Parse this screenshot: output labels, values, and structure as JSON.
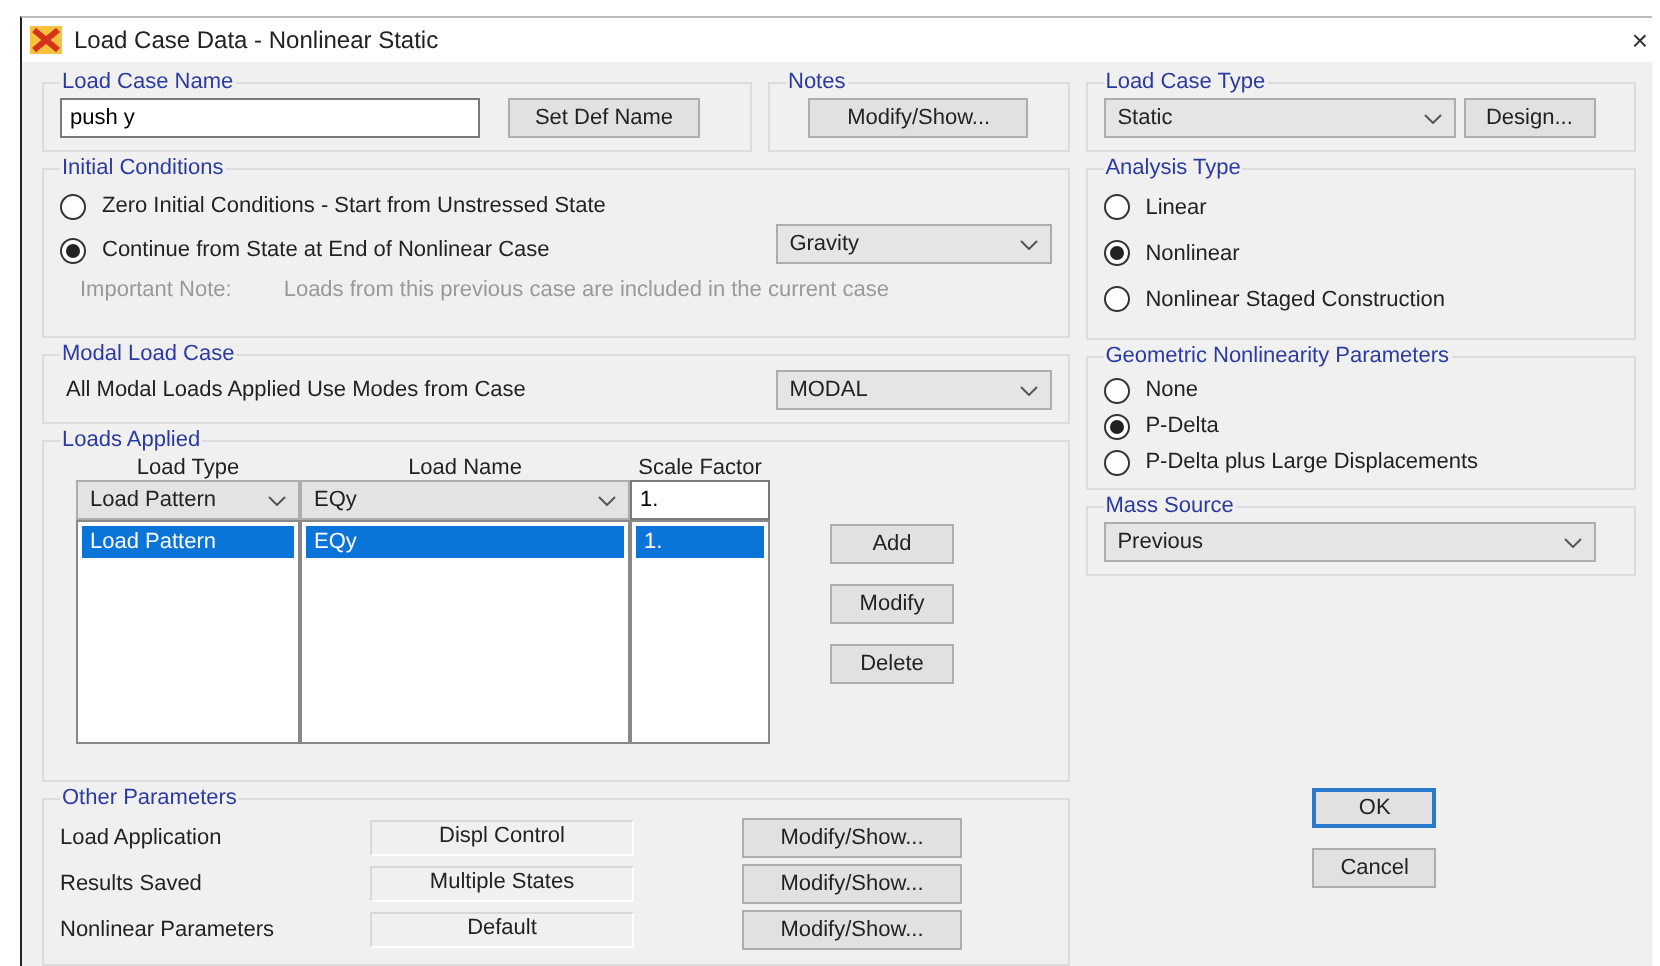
{
  "window": {
    "title": "Load Case Data - Nonlinear Static",
    "close": "×"
  },
  "load_case_name": {
    "legend": "Load Case Name",
    "value": "push y",
    "button": "Set Def Name"
  },
  "notes": {
    "legend": "Notes",
    "button": "Modify/Show..."
  },
  "initial_conditions": {
    "legend": "Initial Conditions",
    "options": [
      {
        "label": "Zero Initial Conditions - Start from Unstressed State",
        "selected": false
      },
      {
        "label": "Continue from State at End of Nonlinear Case",
        "selected": true
      }
    ],
    "dropdown": "Gravity",
    "note_label": "Important Note:",
    "note_text": "Loads from this previous case are included in the current case"
  },
  "modal_load_case": {
    "legend": "Modal Load Case",
    "label": "All Modal Loads Applied Use Modes from Case",
    "dropdown": "MODAL"
  },
  "loads_applied": {
    "legend": "Loads Applied",
    "columns": [
      "Load Type",
      "Load Name",
      "Scale Factor"
    ],
    "editor": {
      "load_type": "Load Pattern",
      "load_name": "EQy",
      "scale_factor": "1."
    },
    "rows": [
      {
        "cells": [
          "Load Pattern",
          "EQy",
          "1."
        ],
        "selected": true
      }
    ],
    "buttons": [
      "Add",
      "Modify",
      "Delete"
    ]
  },
  "other_parameters": {
    "legend": "Other Parameters",
    "rows": [
      {
        "label": "Load Application",
        "value": "Displ Control",
        "button": "Modify/Show..."
      },
      {
        "label": "Results Saved",
        "value": "Multiple States",
        "button": "Modify/Show..."
      },
      {
        "label": "Nonlinear Parameters",
        "value": "Default",
        "button": "Modify/Show..."
      }
    ]
  },
  "load_case_type": {
    "legend": "Load Case Type",
    "value": "Static",
    "button": "Design..."
  },
  "analysis_type": {
    "legend": "Analysis Type",
    "options": [
      {
        "label": "Linear",
        "selected": false
      },
      {
        "label": "Nonlinear",
        "selected": true
      },
      {
        "label": "Nonlinear Staged Construction",
        "selected": false
      }
    ]
  },
  "geometric_nonlinearity": {
    "legend": "Geometric Nonlinearity Parameters",
    "options": [
      {
        "label": "None",
        "selected": false
      },
      {
        "label": "P-Delta",
        "selected": true
      },
      {
        "label": "P-Delta plus Large Displacements",
        "selected": false
      }
    ]
  },
  "mass_source": {
    "legend": "Mass Source",
    "value": "Previous"
  },
  "buttons": [
    {
      "label": "OK",
      "focused": true
    },
    {
      "label": "Cancel",
      "focused": false
    }
  ]
}
